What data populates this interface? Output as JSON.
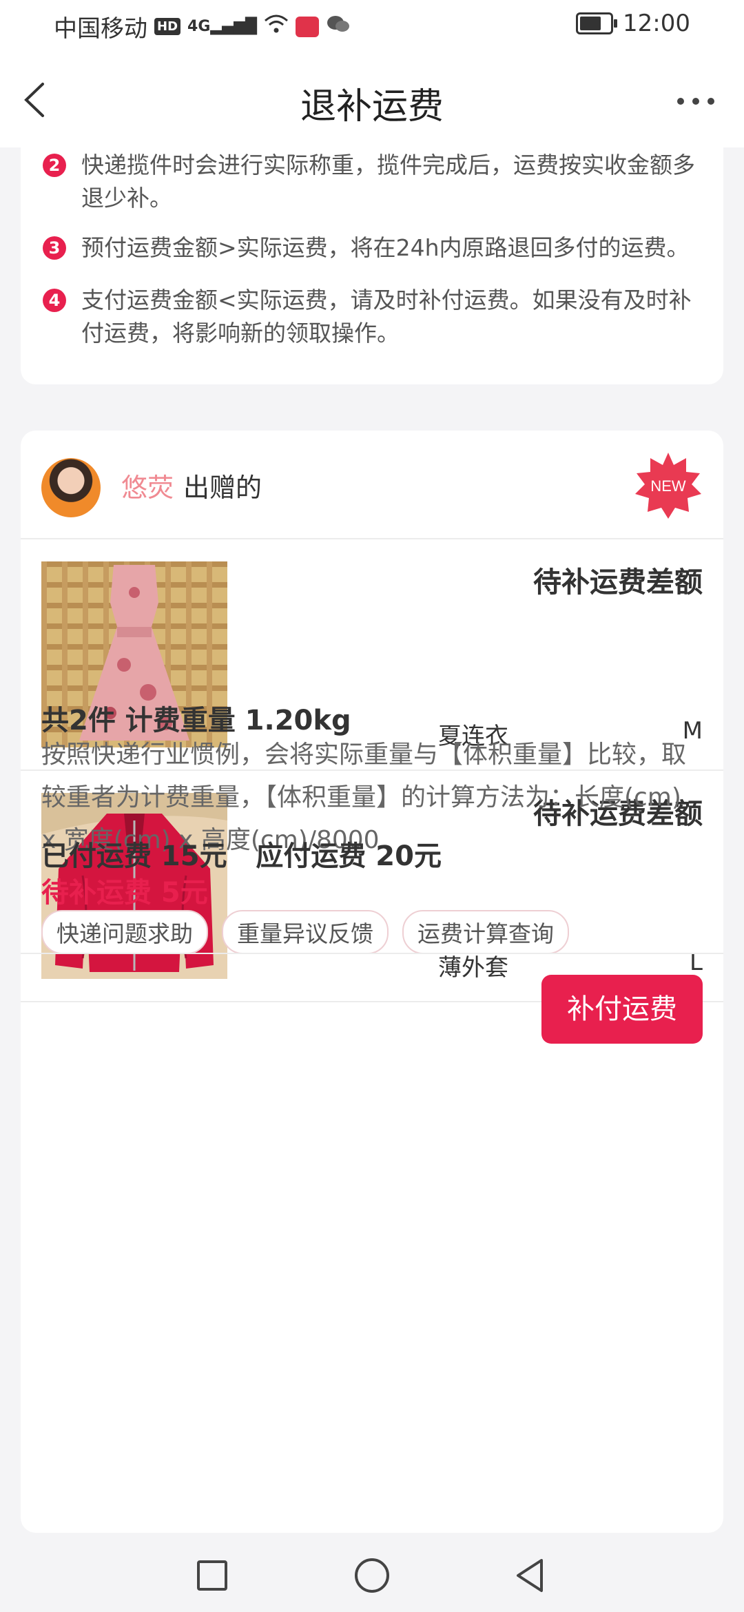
{
  "status_bar": {
    "carrier": "中国移动",
    "hd": "HD",
    "signal": "4G",
    "time": "12:00"
  },
  "header": {
    "title": "退补运费"
  },
  "rules": [
    {
      "num": "2",
      "text": "快递揽件时会进行实际称重，揽件完成后，运费按实收金额多退少补。"
    },
    {
      "num": "3",
      "text": "预付运费金额>实际运费，将在24h内原路退回多付的运费。"
    },
    {
      "num": "4",
      "text": "支付运费金额<实际运费，请及时补付运费。如果没有及时补付运费，将影响新的领取操作。"
    }
  ],
  "order": {
    "donor_name": "悠荧",
    "donor_suffix": "出赠的",
    "new_badge": "NEW",
    "items": [
      {
        "title": "待补运费差额",
        "name": "夏连衣",
        "size": "M"
      },
      {
        "title": "待补运费差额",
        "name": "薄外套",
        "size": "L"
      }
    ],
    "summary_title": "共2件 计费重量 1.20kg",
    "summary_desc": "按照快递行业惯例，会将实际重量与【体积重量】比较，取较重者为计费重量，【体积重量】的计算方法为：长度(cm) x 宽度(cm) x 高度(cm)/8000",
    "paid_line": "已付运费 15元   应付运费 20元",
    "due_line": "待补运费 5元",
    "tags": [
      "快递问题求助",
      "重量异议反馈",
      "运费计算查询"
    ],
    "pay_button": "补付运费"
  },
  "colors": {
    "accent": "#e8204e",
    "donor_name": "#f08a92"
  },
  "icons": [
    "back-arrow-icon",
    "more-dots-icon",
    "new-badge-icon",
    "square-icon",
    "circle-icon",
    "triangle-back-icon"
  ]
}
